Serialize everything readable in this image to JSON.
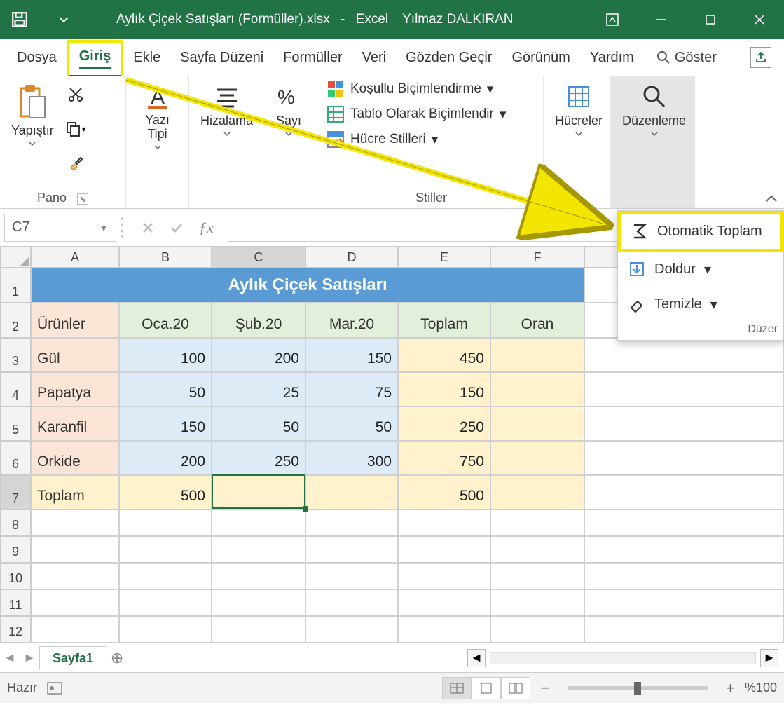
{
  "title": {
    "filename": "Aylık Çiçek Satışları (Formüller).xlsx",
    "sep": "-",
    "app": "Excel",
    "user": "Yılmaz DALKIRAN"
  },
  "tabs": {
    "dosya": "Dosya",
    "giris": "Giriş",
    "ekle": "Ekle",
    "sayfa": "Sayfa Düzeni",
    "formul": "Formüller",
    "veri": "Veri",
    "gozden": "Gözden Geçir",
    "gorunum": "Görünüm",
    "yardim": "Yardım",
    "tell": "Göster"
  },
  "ribbon": {
    "pano": {
      "label": "Pano",
      "paste": "Yapıştır"
    },
    "font": {
      "label": "Yazı Tipi"
    },
    "align": {
      "label": "Hizalama"
    },
    "number": {
      "label": "Sayı"
    },
    "styles": {
      "label": "Stiller",
      "cond": "Koşullu Biçimlendirme",
      "table": "Tablo Olarak Biçimlendir",
      "cellstyles": "Hücre Stilleri"
    },
    "cells": {
      "label": "Hücreler"
    },
    "editing": {
      "label": "Düzenleme"
    }
  },
  "formulabar": {
    "name": "C7"
  },
  "popup": {
    "autosum": "Otomatik Toplam",
    "fill": "Doldur",
    "clear": "Temizle",
    "footer": "Düzer"
  },
  "columns": [
    "A",
    "B",
    "C",
    "D",
    "E",
    "F"
  ],
  "rows": [
    1,
    2,
    3,
    4,
    5,
    6,
    7,
    8,
    9,
    10,
    11,
    12
  ],
  "data": {
    "title": "Aylık Çiçek Satışları",
    "headers": {
      "col0": "Ürünler",
      "col1": "Oca.20",
      "col2": "Şub.20",
      "col3": "Mar.20",
      "col4": "Toplam",
      "col5": "Oran"
    },
    "r3": {
      "name": "Gül",
      "b": "100",
      "c": "200",
      "d": "150",
      "e": "450"
    },
    "r4": {
      "name": "Papatya",
      "b": "50",
      "c": "25",
      "d": "75",
      "e": "150"
    },
    "r5": {
      "name": "Karanfil",
      "b": "150",
      "c": "50",
      "d": "50",
      "e": "250"
    },
    "r6": {
      "name": "Orkide",
      "b": "200",
      "c": "250",
      "d": "300",
      "e": "750"
    },
    "r7": {
      "name": "Toplam",
      "b": "500",
      "e": "500"
    }
  },
  "sheettab": {
    "name": "Sayfa1"
  },
  "status": {
    "ready": "Hazır",
    "zoom": "%100"
  }
}
